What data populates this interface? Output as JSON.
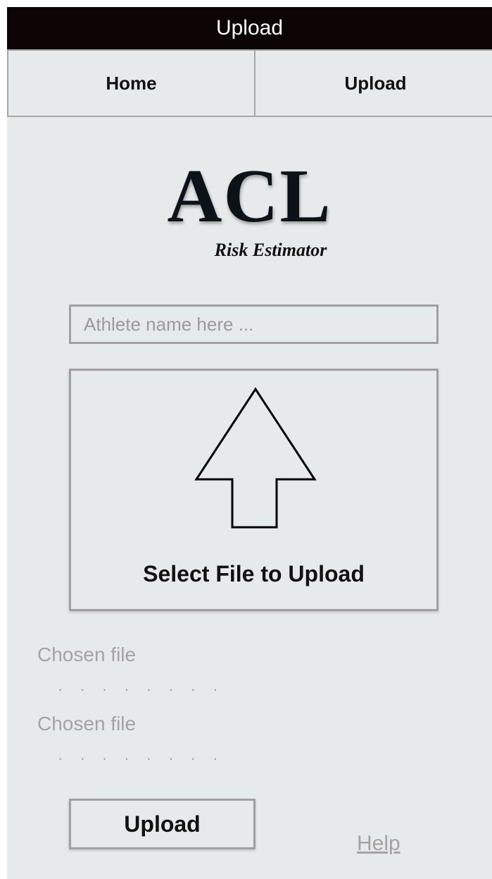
{
  "window": {
    "title": "Upload"
  },
  "nav": {
    "home_label": "Home",
    "upload_label": "Upload"
  },
  "logo": {
    "main": "ACL",
    "sub": "Risk Estimator"
  },
  "form": {
    "athlete_placeholder": "Athlete name here ...",
    "athlete_value": "",
    "drop_zone_label": "Select File to Upload",
    "drop_zone_icon": "upload-arrow-icon"
  },
  "chosen_files": [
    {
      "label": "Chosen file",
      "value": "· · · · · · · ·"
    },
    {
      "label": "Chosen file",
      "value": "· · · · · · · ·"
    }
  ],
  "actions": {
    "upload_label": "Upload",
    "help_label": "Help"
  },
  "colors": {
    "background": "#e7eaeb",
    "title_bar": "#0d0406",
    "border": "#a0a0a0",
    "muted_text": "#a3a3a3"
  }
}
